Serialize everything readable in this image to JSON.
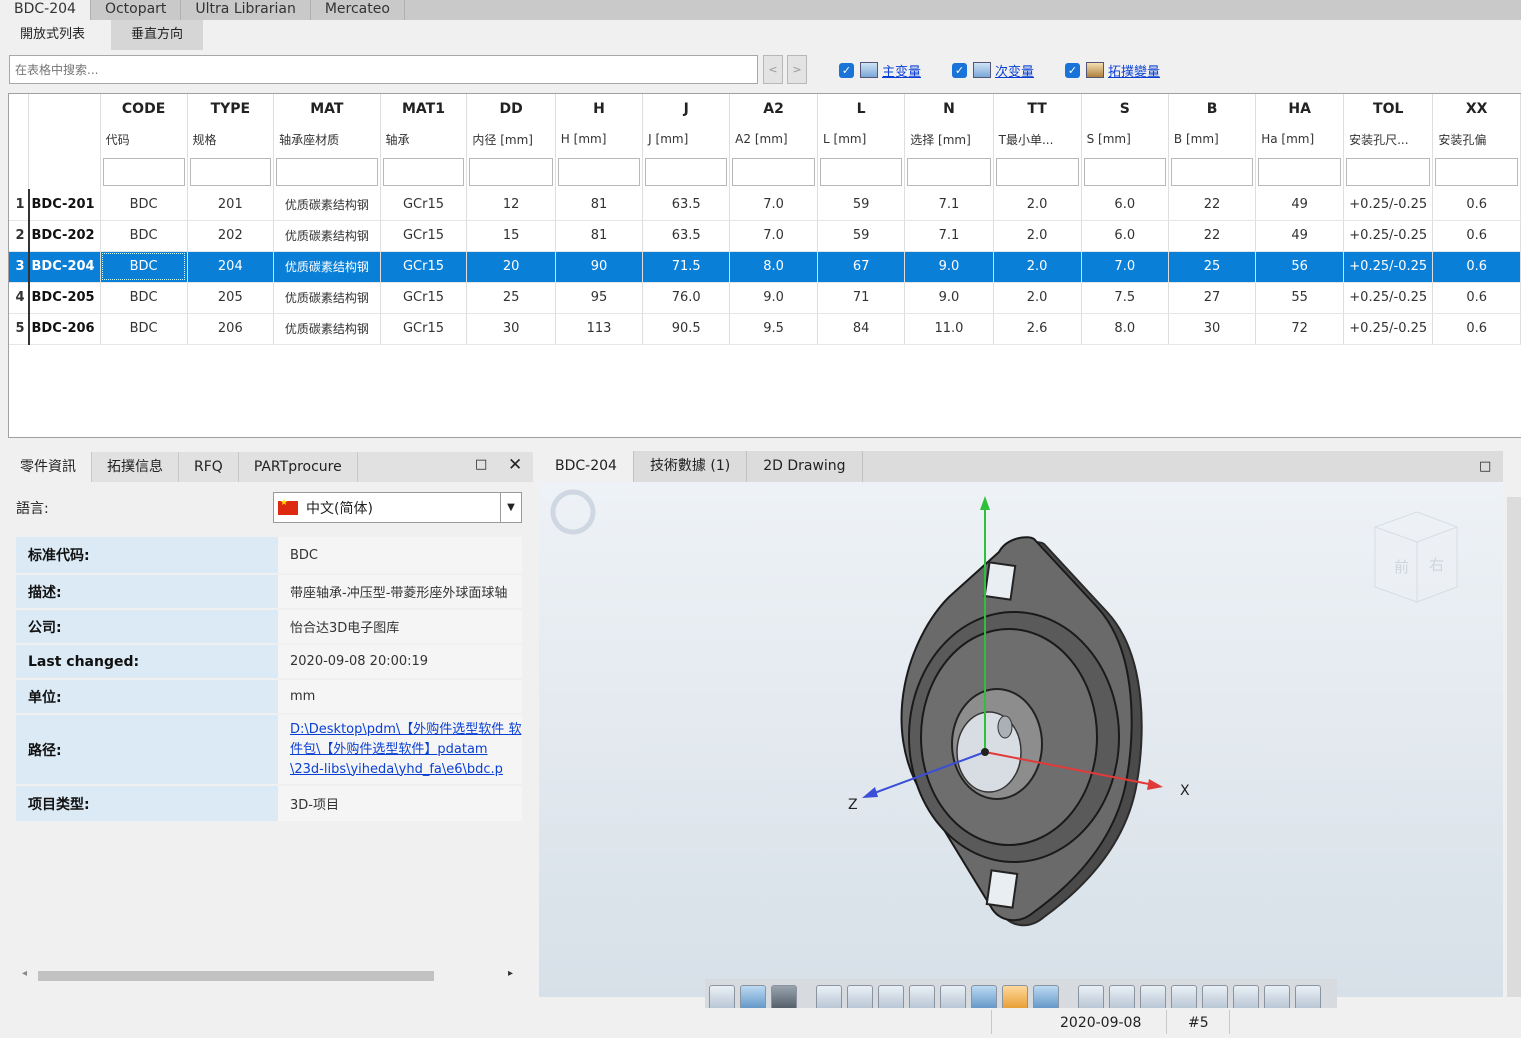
{
  "top_tabs": [
    "BDC-204",
    "Octopart",
    "Ultra Librarian",
    "Mercateo"
  ],
  "sub_tabs": [
    "開放式列表",
    "垂直方向"
  ],
  "search": {
    "placeholder": "在表格中搜索...",
    "prev": "<",
    "next": ">"
  },
  "checks": [
    {
      "label": "主变量",
      "checked": true
    },
    {
      "label": "次变量",
      "checked": true
    },
    {
      "label": "拓撲變量",
      "checked": true
    }
  ],
  "table": {
    "columns": [
      {
        "code": "CODE",
        "desc": "代码"
      },
      {
        "code": "TYPE",
        "desc": "规格"
      },
      {
        "code": "MAT",
        "desc": "轴承座材质"
      },
      {
        "code": "MAT1",
        "desc": "轴承"
      },
      {
        "code": "DD",
        "desc": "内径 [mm]"
      },
      {
        "code": "H",
        "desc": "H [mm]"
      },
      {
        "code": "J",
        "desc": "J [mm]"
      },
      {
        "code": "A2",
        "desc": "A2 [mm]"
      },
      {
        "code": "L",
        "desc": "L [mm]"
      },
      {
        "code": "N",
        "desc": "选择 [mm]"
      },
      {
        "code": "TT",
        "desc": "T最小单..."
      },
      {
        "code": "S",
        "desc": "S [mm]"
      },
      {
        "code": "B",
        "desc": "B [mm]"
      },
      {
        "code": "HA",
        "desc": "Ha [mm]"
      },
      {
        "code": "TOL",
        "desc": "安装孔尺..."
      },
      {
        "code": "XX",
        "desc": "安装孔偏"
      }
    ],
    "rows": [
      {
        "n": "1",
        "part": "BDC-201",
        "cells": [
          "BDC",
          "201",
          "优质碳素结构钢",
          "GCr15",
          "12",
          "81",
          "63.5",
          "7.0",
          "59",
          "7.1",
          "2.0",
          "6.0",
          "22",
          "49",
          "+0.25/-0.25",
          "0.6"
        ]
      },
      {
        "n": "2",
        "part": "BDC-202",
        "cells": [
          "BDC",
          "202",
          "优质碳素结构钢",
          "GCr15",
          "15",
          "81",
          "63.5",
          "7.0",
          "59",
          "7.1",
          "2.0",
          "6.0",
          "22",
          "49",
          "+0.25/-0.25",
          "0.6"
        ]
      },
      {
        "n": "3",
        "part": "BDC-204",
        "cells": [
          "BDC",
          "204",
          "优质碳素结构钢",
          "GCr15",
          "20",
          "90",
          "71.5",
          "8.0",
          "67",
          "9.0",
          "2.0",
          "7.0",
          "25",
          "56",
          "+0.25/-0.25",
          "0.6"
        ]
      },
      {
        "n": "4",
        "part": "BDC-205",
        "cells": [
          "BDC",
          "205",
          "优质碳素结构钢",
          "GCr15",
          "25",
          "95",
          "76.0",
          "9.0",
          "71",
          "9.0",
          "2.0",
          "7.5",
          "27",
          "55",
          "+0.25/-0.25",
          "0.6"
        ]
      },
      {
        "n": "5",
        "part": "BDC-206",
        "cells": [
          "BDC",
          "206",
          "优质碳素结构钢",
          "GCr15",
          "30",
          "113",
          "90.5",
          "9.5",
          "84",
          "11.0",
          "2.6",
          "8.0",
          "30",
          "72",
          "+0.25/-0.25",
          "0.6"
        ]
      }
    ],
    "selected_row": "3"
  },
  "left_panel": {
    "tabs": [
      "零件資訊",
      "拓撲信息",
      "RFQ",
      "PARTprocure"
    ],
    "max_icon": "□",
    "close_icon": "✕",
    "language_label": "語言:",
    "language_value": "中文(简体)",
    "props": [
      {
        "k": "标准代码:",
        "v": "BDC"
      },
      {
        "k": "描述:",
        "v": "带座轴承-冲压型-带菱形座外球面球轴"
      },
      {
        "k": "公司:",
        "v": "怡合达3D电子图库"
      },
      {
        "k": "Last changed:",
        "v": "2020-09-08 20:00:19"
      },
      {
        "k": "单位:",
        "v": "mm"
      },
      {
        "k": "路径:",
        "v": "D:\\Desktop\\pdm\\【外购件选型软件 软件包\\【外购件选型软件】pdatam \\23d-libs\\yiheda\\yhd_fa\\e6\\bdc.p"
      },
      {
        "k": "项目类型:",
        "v": "3D-项目"
      }
    ]
  },
  "right_panel": {
    "tabs": [
      "BDC-204",
      "技術數據 (1)",
      "2D Drawing"
    ],
    "max_icon": "□",
    "axes": {
      "x": "X",
      "z": "Z"
    },
    "cube_faces": [
      "前",
      "右"
    ]
  },
  "status": {
    "date": "2020-09-08",
    "count": "#5"
  }
}
